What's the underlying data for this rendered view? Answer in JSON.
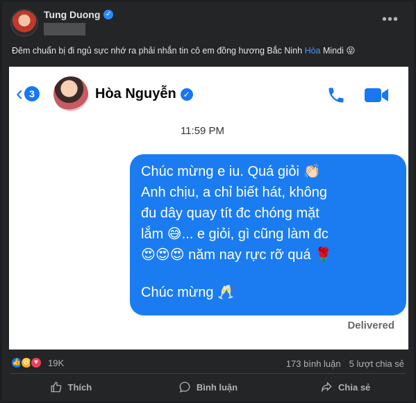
{
  "post": {
    "author": "Tung Duong",
    "caption_before": "Đêm chuẩn bị đi ngủ sực nhớ ra phải nhắn tin cô em đồng hương Bắc Ninh ",
    "caption_link": "Hòa",
    "caption_after": " Mindi 😝"
  },
  "chat": {
    "back_count": "3",
    "contact_name": "Hòa Nguyễn",
    "time": "11:59 PM",
    "message_lines": [
      "Chúc mừng e iu. Quá giỏi 👏🏻",
      "Anh chịu, a chỉ biết hát, không",
      "đu dây quay tít đc chóng mặt",
      "lắm 😅... e giỏi, gì cũng làm đc",
      "😍😍😍 năm nay rực rỡ quá 🌹"
    ],
    "message_last": "Chúc mừng 🥂",
    "status": "Delivered"
  },
  "footer": {
    "reaction_count": "19K",
    "comments": "173 bình luận",
    "shares": "5 lượt chia sẻ",
    "like_label": "Thích",
    "comment_label": "Bình luận",
    "share_label": "Chia sẻ"
  },
  "colors": {
    "post_bg": "#242526",
    "bubble": "#1a7cf0",
    "accent": "#1877f2"
  }
}
